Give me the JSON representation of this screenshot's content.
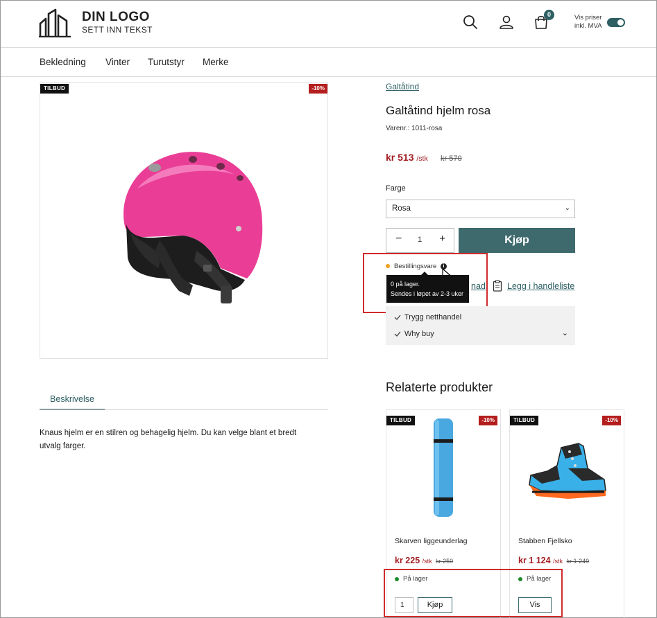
{
  "header": {
    "logo_title": "DIN LOGO",
    "logo_subtitle": "SETT INN TEKST",
    "cart_count": "0",
    "vat_toggle_label_line1": "Vis priser",
    "vat_toggle_label_line2": "inkl. MVA",
    "vat_toggle_on": true
  },
  "nav": {
    "items": [
      "Bekledning",
      "Vinter",
      "Turutstyr",
      "Merke"
    ]
  },
  "product": {
    "sale_tag": "TILBUD",
    "discount_tag": "-10%",
    "brand": "Galtåtind",
    "title": "Galtåtind hjelm rosa",
    "sku": "Varenr.: 1011-rosa",
    "price": "kr 513",
    "price_unit": "/stk",
    "price_old": "kr 570",
    "color_label": "Farge",
    "color_selected": "Rosa",
    "quantity": "1",
    "buy_label": "Kjøp",
    "stock_status": "Bestillingsvare",
    "stock_color": "#f0a020",
    "tooltip_line1": "0 på lager.",
    "tooltip_line2": "Sendes i løpet av 2-3 uker",
    "compare_link_partial": "nad",
    "wishlist_link": "Legg i handleliste",
    "usp_items": [
      "Trygg netthandel",
      "Why buy"
    ]
  },
  "tabs": {
    "description_tab": "Beskrivelse",
    "description_text": "Knaus hjelm er en stilren og behagelig hjelm. Du kan velge blant et bredt utvalg farger."
  },
  "related": {
    "title": "Relaterte produkter",
    "items": [
      {
        "sale_tag": "TILBUD",
        "discount_tag": "-10%",
        "name": "Skarven liggeunderlag",
        "price": "kr 225",
        "price_unit": "/stk",
        "price_old": "kr 250",
        "stock": "På lager",
        "quantity": "1",
        "button": "Kjøp"
      },
      {
        "sale_tag": "TILBUD",
        "discount_tag": "-10%",
        "name": "Stabben Fjellsko",
        "price": "kr 1 124",
        "price_unit": "/stk",
        "price_old": "kr 1 249",
        "stock": "På lager",
        "button": "Vis"
      }
    ]
  },
  "colors": {
    "accent": "#2d5f63",
    "button": "#3e6a6d",
    "price": "#a31d22",
    "sale_badge": "#b41e1e",
    "in_stock": "#1f8a2e",
    "highlight": "#d12b2b"
  }
}
